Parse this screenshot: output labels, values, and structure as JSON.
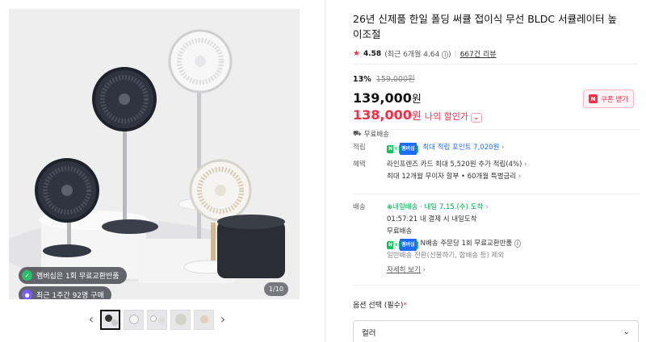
{
  "gallery": {
    "badges": [
      {
        "label": "멤버십은 1회 무료교환반품",
        "icon": "membership-check-icon"
      },
      {
        "label": "최근 1주간 92명 구매",
        "icon": "purchase-count-icon"
      }
    ],
    "counter": "1/10",
    "thumbnail_count": 5,
    "active_thumbnail": 0
  },
  "product": {
    "title": "26년 신제품 한일 폴딩 써큘 접이식 무선 BLDC 서큘레이터 높이조절",
    "rating": {
      "score": "4.58",
      "recent": "(최근 6개월 4.64",
      "recent_close": ")",
      "reviews": "667건 리뷰"
    },
    "discount_pct": "13%",
    "original_price": "159,000원",
    "price": "139,000",
    "price_unit": "원",
    "my_price": "138,000",
    "my_price_unit": "원",
    "my_price_label": "나의 할인가",
    "coupon_label": "쿠폰 받기",
    "free_shipping": "무료배송"
  },
  "benefits": {
    "points_label": "적립",
    "points_badge": "멤버십",
    "points_text": "최대 적립 포인트 7,020원",
    "card_label": "혜택",
    "card_line1": "라인프렌즈 카드 최대 5,520원 추가 적립(4%)",
    "card_line2": "최대 12개월 무이자 할부 • 60개월 특별금리"
  },
  "delivery": {
    "label": "배송",
    "badge": "내일배송",
    "eta": "· 내일 7.15.(수) 도착",
    "cutoff": "01:57:21  내 결제 시 내일도착",
    "fee": "무료배송",
    "exchange_badge": "멤버십",
    "exchange": "N배송 주문당 1회 무료교환반품",
    "exclusion": "일반배송 전환(선물하기, 합배송 등) 제외",
    "details_link": "자세히 보기"
  },
  "options": {
    "label": "옵션 선택 (필수)",
    "required_mark": "*",
    "selected": "컬러"
  },
  "colors": {
    "accent": "#ff2a44",
    "naver_green": "#03c75a",
    "link_blue": "#1d6cff"
  }
}
